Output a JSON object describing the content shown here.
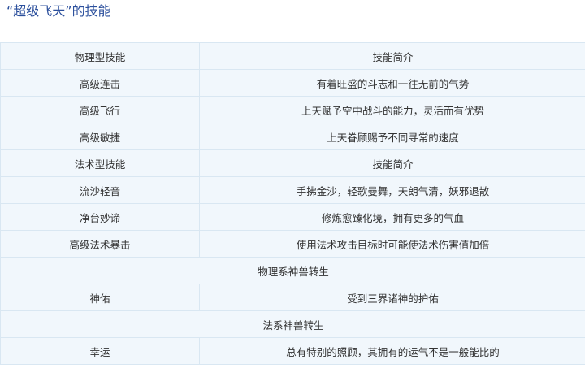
{
  "title": "“超级飞天”的技能",
  "rows": [
    {
      "type": "pair",
      "left": "物理型技能",
      "right": "技能简介"
    },
    {
      "type": "pair",
      "left": "高级连击",
      "right": "有着旺盛的斗志和一往无前的气势"
    },
    {
      "type": "pair",
      "left": "高级飞行",
      "right": "上天赋予空中战斗的能力，灵活而有优势"
    },
    {
      "type": "pair",
      "left": "高级敏捷",
      "right": "上天眷顾赐予不同寻常的速度"
    },
    {
      "type": "pair",
      "left": "法术型技能",
      "right": "技能简介"
    },
    {
      "type": "pair",
      "left": "流沙轻音",
      "right": "手拂金沙，轻歌曼舞，天朗气清，妖邪退散"
    },
    {
      "type": "pair",
      "left": "净台妙谛",
      "right": "修炼愈臻化境，拥有更多的气血"
    },
    {
      "type": "pair",
      "left": "高级法术暴击",
      "right": "使用法术攻击目标时可能使法术伤害值加倍"
    },
    {
      "type": "span",
      "text": "物理系神兽转生"
    },
    {
      "type": "pair",
      "left": "神佑",
      "right": "受到三界诸神的护佑"
    },
    {
      "type": "span",
      "text": "法系神兽转生"
    },
    {
      "type": "pair",
      "left": "幸运",
      "right": "总有特别的照顾，其拥有的运气不是一般能比的"
    }
  ]
}
